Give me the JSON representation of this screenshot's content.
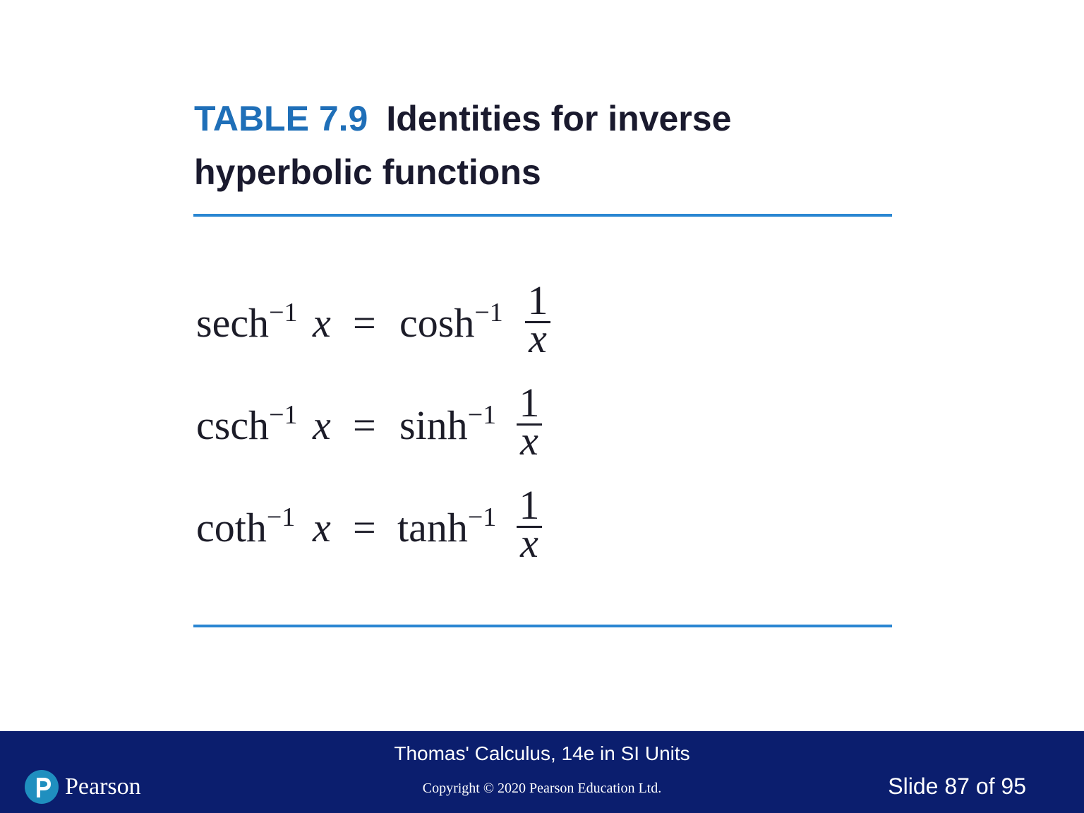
{
  "heading": {
    "table_label": "TABLE 7.9",
    "title": "Identities for inverse hyperbolic functions"
  },
  "equations": [
    {
      "lhs": "sech",
      "exponent": "−1",
      "var": "x",
      "equals": "=",
      "rhs": "cosh",
      "frac_num": "1",
      "frac_den": "x"
    },
    {
      "lhs": "csch",
      "exponent": "−1",
      "var": "x",
      "equals": "=",
      "rhs": "sinh",
      "frac_num": "1",
      "frac_den": "x"
    },
    {
      "lhs": "coth",
      "exponent": "−1",
      "var": "x",
      "equals": "=",
      "rhs": "tanh",
      "frac_num": "1",
      "frac_den": "x"
    }
  ],
  "footer": {
    "book_title": "Thomas' Calculus, 14e in SI Units",
    "copyright": "Copyright © 2020 Pearson Education Ltd.",
    "slide_number": "Slide 87 of 95",
    "logo_text": "Pearson",
    "logo_icon": "pearson-p-logo-icon"
  },
  "colors": {
    "accent_blue": "#1f6fb8",
    "rule_blue": "#2a86d2",
    "footer_navy": "#0b1e6e",
    "logo_teal": "#1f8fbf"
  }
}
